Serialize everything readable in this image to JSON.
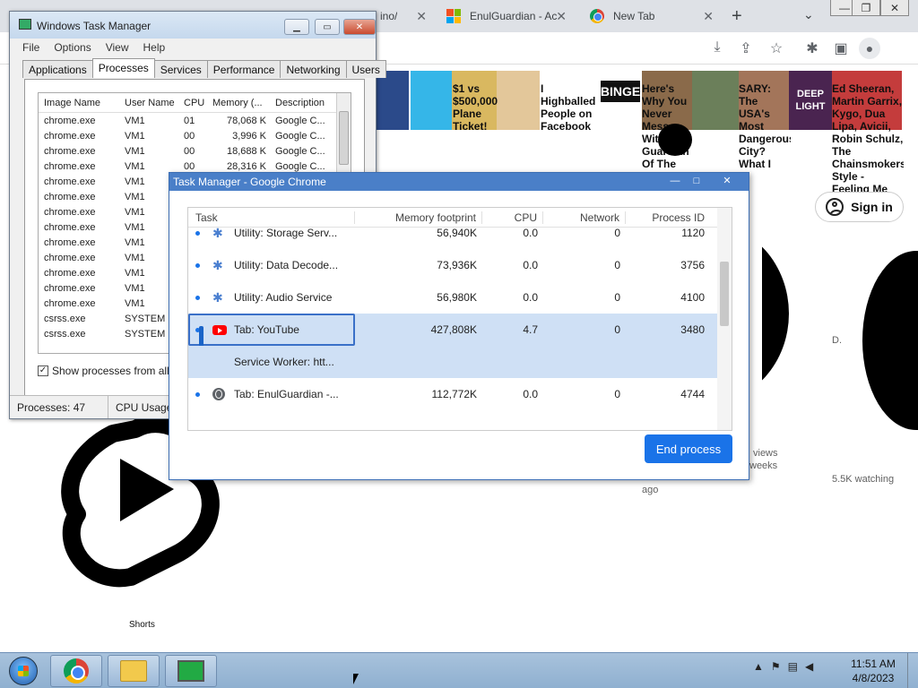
{
  "browser": {
    "tabs": [
      {
        "title": "ino/"
      },
      {
        "title": "EnulGuardian - Ac"
      },
      {
        "title": "New Tab"
      }
    ],
    "new_tab_symbol": "+",
    "dropdown_symbol": "⌄",
    "window_controls": [
      "—",
      "❐",
      "✕"
    ]
  },
  "youtube": {
    "video_titles": [
      "$1 vs $500,000 Plane Ticket!",
      "I Highballed People on Facebook Marketplace",
      "Here's Why You Never Mess With A Guardian Of The Unknown",
      "SARY: The USA's Most Dangerous City? What I Actually Saw",
      "Ed Sheeran, Martin Garrix, Kygo, Dua Lipa, Avicii, Robin Schulz, The Chainsmokers Style - Feeling Me"
    ],
    "binge_label": "BINGE",
    "deeplight_label": "DEEP LIGHT",
    "signin_label": "Sign in",
    "shorts_label": "Shorts",
    "views_label": "views",
    "weeks_label": "weeks",
    "ago_label": "ago",
    "watching_label": "5.5K watching",
    "d_label": "D."
  },
  "win_task_manager": {
    "title": "Windows Task Manager",
    "menu": [
      "File",
      "Options",
      "View",
      "Help"
    ],
    "tabs": [
      "Applications",
      "Processes",
      "Services",
      "Performance",
      "Networking",
      "Users"
    ],
    "active_tab": "Processes",
    "columns": [
      "Image Name",
      "User Name",
      "CPU",
      "Memory (...",
      "Description"
    ],
    "rows": [
      [
        "chrome.exe",
        "VM1",
        "01",
        "78,068 K",
        "Google C..."
      ],
      [
        "chrome.exe",
        "VM1",
        "00",
        "3,996 K",
        "Google C..."
      ],
      [
        "chrome.exe",
        "VM1",
        "00",
        "18,688 K",
        "Google C..."
      ],
      [
        "chrome.exe",
        "VM1",
        "00",
        "28,316 K",
        "Google C..."
      ],
      [
        "chrome.exe",
        "VM1",
        "",
        "",
        ""
      ],
      [
        "chrome.exe",
        "VM1",
        "",
        "",
        ""
      ],
      [
        "chrome.exe",
        "VM1",
        "",
        "",
        ""
      ],
      [
        "chrome.exe",
        "VM1",
        "",
        "",
        ""
      ],
      [
        "chrome.exe",
        "VM1",
        "",
        "",
        ""
      ],
      [
        "chrome.exe",
        "VM1",
        "",
        "",
        ""
      ],
      [
        "chrome.exe",
        "VM1",
        "",
        "",
        ""
      ],
      [
        "chrome.exe",
        "VM1",
        "",
        "",
        ""
      ],
      [
        "chrome.exe",
        "VM1",
        "",
        "",
        ""
      ],
      [
        "csrss.exe",
        "SYSTEM",
        "",
        "",
        ""
      ],
      [
        "csrss.exe",
        "SYSTEM",
        "",
        "",
        ""
      ]
    ],
    "show_all_label": "Show processes from all us",
    "show_all_checked": "✓",
    "status_processes": "Processes: 47",
    "status_cpu": "CPU Usage"
  },
  "chrome_task_manager": {
    "title": "Task Manager - Google Chrome",
    "controls": [
      "—",
      "□",
      "✕"
    ],
    "columns": [
      "Task",
      "Memory footprint",
      "CPU",
      "Network",
      "Process ID"
    ],
    "rows": [
      {
        "icon": "extension-icon",
        "task": "Utility: Storage Serv...",
        "memory": "56,940K",
        "cpu": "0.0",
        "network": "0",
        "pid": "1120"
      },
      {
        "icon": "extension-icon",
        "task": "Utility: Data Decode...",
        "memory": "73,936K",
        "cpu": "0.0",
        "network": "0",
        "pid": "3756"
      },
      {
        "icon": "extension-icon",
        "task": "Utility: Audio Service",
        "memory": "56,980K",
        "cpu": "0.0",
        "network": "0",
        "pid": "4100"
      },
      {
        "icon": "youtube-icon",
        "task": "Tab: YouTube",
        "memory": "427,808K",
        "cpu": "4.7",
        "network": "0",
        "pid": "3480"
      },
      {
        "icon": "",
        "task": "Service Worker: htt...",
        "memory": "",
        "cpu": "",
        "network": "",
        "pid": ""
      },
      {
        "icon": "globe-icon",
        "task": "Tab: EnulGuardian -...",
        "memory": "112,772K",
        "cpu": "0.0",
        "network": "0",
        "pid": "4744"
      }
    ],
    "end_process_label": "End process"
  },
  "taskbar": {
    "time": "11:51 AM",
    "date": "4/8/2023",
    "tray_up": "▲"
  }
}
